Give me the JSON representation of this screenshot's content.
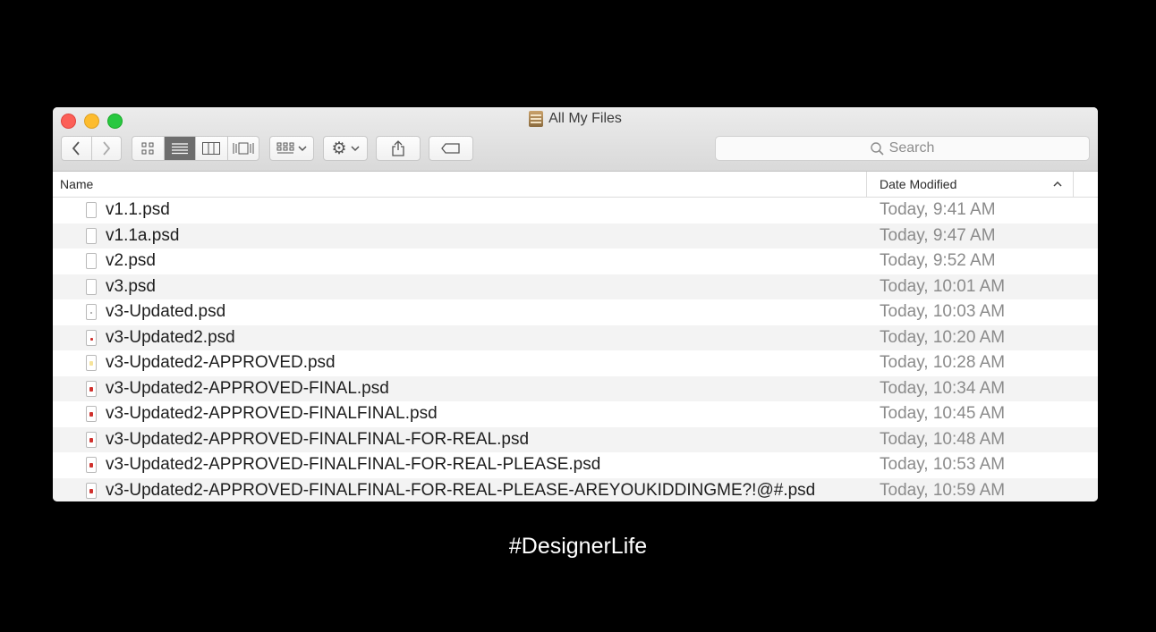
{
  "window": {
    "title": "All My Files"
  },
  "toolbar": {
    "back_icon": "chevron-left-icon",
    "forward_icon": "chevron-right-icon",
    "view_icons": [
      "icon-view-icon",
      "list-view-icon",
      "column-view-icon",
      "cover-flow-icon"
    ],
    "arrange_icon": "arrange-grid-icon",
    "action_icon": "gear-icon",
    "share_icon": "share-icon",
    "tag_icon": "tag-icon",
    "search_placeholder": "Search"
  },
  "columns": {
    "name": "Name",
    "date": "Date Modified"
  },
  "files": [
    {
      "name": "v1.1.psd",
      "date": "Today, 9:41 AM",
      "mark": "none"
    },
    {
      "name": "v1.1a.psd",
      "date": "Today, 9:47 AM",
      "mark": "none"
    },
    {
      "name": "v2.psd",
      "date": "Today, 9:52 AM",
      "mark": "none"
    },
    {
      "name": "v3.psd",
      "date": "Today, 10:01 AM",
      "mark": "none"
    },
    {
      "name": "v3-Updated.psd",
      "date": "Today, 10:03 AM",
      "mark": "tiny"
    },
    {
      "name": "v3-Updated2.psd",
      "date": "Today, 10:20 AM",
      "mark": "small"
    },
    {
      "name": "v3-Updated2-APPROVED.psd",
      "date": "Today, 10:28 AM",
      "mark": "faint"
    },
    {
      "name": "v3-Updated2-APPROVED-FINAL.psd",
      "date": "Today, 10:34 AM",
      "mark": "red"
    },
    {
      "name": "v3-Updated2-APPROVED-FINALFINAL.psd",
      "date": "Today, 10:45 AM",
      "mark": "red"
    },
    {
      "name": "v3-Updated2-APPROVED-FINALFINAL-FOR-REAL.psd",
      "date": "Today, 10:48 AM",
      "mark": "red"
    },
    {
      "name": "v3-Updated2-APPROVED-FINALFINAL-FOR-REAL-PLEASE.psd",
      "date": "Today, 10:53 AM",
      "mark": "red"
    },
    {
      "name": "v3-Updated2-APPROVED-FINALFINAL-FOR-REAL-PLEASE-AREYOUKIDDINGME?!@#.psd",
      "date": "Today, 10:59 AM",
      "mark": "red"
    }
  ],
  "caption": "#DesignerLife",
  "colors": {
    "background": "#000000",
    "mark_red": "#d0312d"
  }
}
